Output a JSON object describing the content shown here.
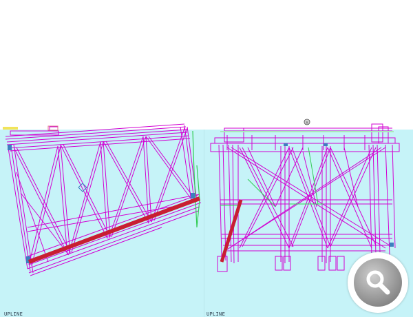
{
  "left_viewport": {
    "label": "UPLINE"
  },
  "right_viewport": {
    "label": "UPLINE",
    "marker": "®"
  },
  "zoom_button": {
    "icon": "magnifier-icon"
  },
  "colors": {
    "water": "#c6f3f8",
    "truss": "#d200d2",
    "highlight_member": "#c81e32",
    "green_members": "#33cc55",
    "blue_nodes": "#3d7fbf"
  }
}
